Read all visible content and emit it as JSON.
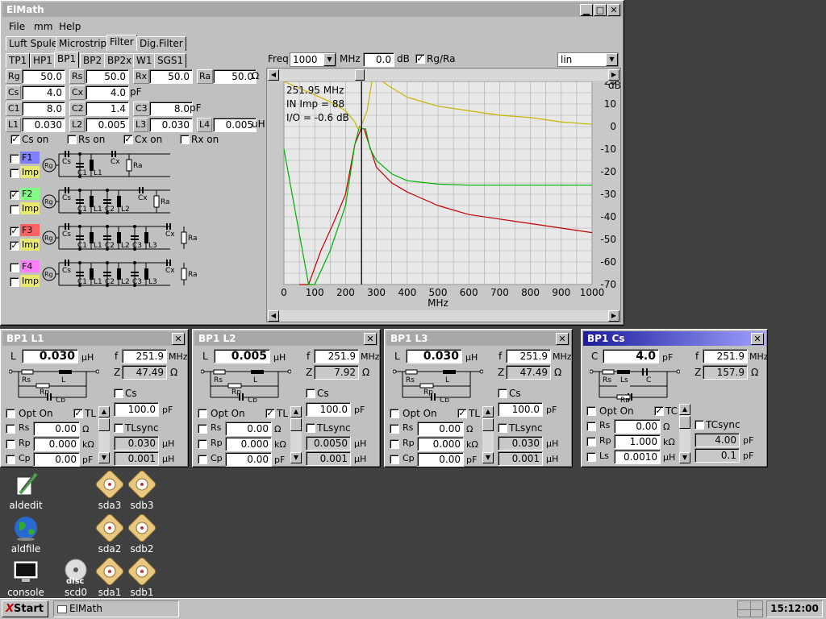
{
  "main": {
    "title": "ElMath",
    "menu": [
      "File",
      "mm",
      "Help"
    ],
    "tabs": [
      "Luft Spule",
      "Microstrip",
      "Filter",
      "Dig.Filter"
    ],
    "subtabs": [
      "TP1",
      "HP1",
      "BP1",
      "BP2",
      "BP2x",
      "W1",
      "SGS1"
    ],
    "params": [
      {
        "label": "Rg",
        "value": "50.0"
      },
      {
        "label": "Rs",
        "value": "50.0"
      },
      {
        "label": "Rx",
        "value": "50.0"
      },
      {
        "label": "Ra",
        "value": "50.0"
      },
      {
        "label": "Cs",
        "value": "4.0"
      },
      {
        "label": "Cx",
        "value": "4.0"
      },
      {
        "label": "C1",
        "value": "8.0"
      },
      {
        "label": "C2",
        "value": "1.4"
      },
      {
        "label": "C3",
        "value": "8.0"
      },
      {
        "label": "L1",
        "value": "0.030"
      },
      {
        "label": "L2",
        "value": "0.005"
      },
      {
        "label": "L3",
        "value": "0.030"
      },
      {
        "label": "L4",
        "value": "0.005"
      }
    ],
    "units": {
      "ohm": "Ω",
      "pf": "pF",
      "uh": "uH"
    },
    "checks": {
      "cs_on": "Cs on",
      "rs_on": "Rs on",
      "cx_on": "Cx on",
      "rx_on": "Rx on"
    },
    "filters": [
      {
        "name": "F1",
        "color": "#8080ff",
        "checked": false,
        "imp": false
      },
      {
        "name": "F2",
        "color": "#80ff80",
        "checked": true,
        "imp": false
      },
      {
        "name": "F3",
        "color": "#ff6060",
        "checked": true,
        "imp": true
      },
      {
        "name": "F4",
        "color": "#ff80ff",
        "checked": false,
        "imp": false
      }
    ],
    "imp_label": "Imp",
    "freq_label": "Freq",
    "freq_value": "1000",
    "mhz_label": "MHz",
    "db_value": "0.0",
    "db_label": "dB",
    "rg_ra_label": "Rg/Ra",
    "scale_value": "lin",
    "readout": [
      "251.95 MHz",
      "IN Imp = 88",
      "I/O = -0.6 dB"
    ]
  },
  "chart_data": {
    "type": "line",
    "xlabel": "MHz",
    "ylabel": "dB",
    "xlim": [
      0,
      1000
    ],
    "ylim": [
      -70,
      20
    ],
    "xticks": [
      0,
      100,
      200,
      300,
      400,
      500,
      600,
      700,
      800,
      900,
      1000
    ],
    "yticks": [
      20,
      10,
      0,
      -10,
      -20,
      -30,
      -40,
      -50,
      -60,
      -70
    ],
    "cursor_x": 252,
    "grid": true,
    "series": [
      {
        "color": "#c00000",
        "x": [
          50,
          80,
          120,
          160,
          200,
          230,
          250,
          260,
          300,
          350,
          400,
          500,
          600,
          700,
          800,
          900,
          1000
        ],
        "y": [
          -70,
          -70,
          -55,
          -43,
          -30,
          -8,
          -1,
          -1,
          -18,
          -25,
          -29,
          -35,
          -39,
          -41,
          -43,
          -45,
          -47
        ]
      },
      {
        "color": "#00b000",
        "x": [
          0,
          80,
          100,
          150,
          200,
          230,
          245,
          255,
          265,
          280,
          300,
          350,
          400,
          500,
          600,
          700,
          800,
          1000
        ],
        "y": [
          -10,
          -70,
          -70,
          -55,
          -35,
          -8,
          0,
          -1,
          -1,
          -10,
          -15,
          -21,
          -24,
          -25.5,
          -26,
          -26,
          -26,
          -26
        ]
      },
      {
        "color": "#c8b400",
        "x": [
          0,
          50,
          100,
          150,
          200,
          230,
          240,
          250,
          270,
          290,
          300,
          310,
          320,
          340,
          400,
          500,
          600,
          700,
          800,
          900,
          1000
        ],
        "y": [
          20,
          17,
          14,
          11,
          7,
          2,
          -1,
          0,
          7,
          24,
          26,
          24,
          20,
          18,
          13,
          9,
          7,
          5,
          4,
          2,
          1
        ]
      }
    ]
  },
  "dialogs": [
    {
      "title": "BP1 L1",
      "main_label": "L",
      "main_value": "0.030",
      "main_unit": "µH",
      "f_value": "251.9",
      "z_value": "47.49",
      "check_label": "Cs",
      "check2_value": "100.0",
      "check2_unit": "pF",
      "sync_label": "TLsync",
      "sync_checked": false,
      "v1": "0.030",
      "v1u": "µH",
      "v2": "0.001",
      "v2u": "µH",
      "opt_label": "Opt On",
      "tl_label": "TL",
      "tl_checked": true,
      "rows": [
        {
          "label": "Rs",
          "value": "0.00",
          "unit": "Ω"
        },
        {
          "label": "Rp",
          "value": "0.000",
          "unit": "kΩ"
        },
        {
          "label": "Cp",
          "value": "0.00",
          "unit": "pF"
        }
      ],
      "active": false,
      "circuit": "L"
    },
    {
      "title": "BP1 L2",
      "main_label": "L",
      "main_value": "0.005",
      "main_unit": "µH",
      "f_value": "251.9",
      "z_value": "7.92",
      "check_label": "Cs",
      "check2_value": "100.0",
      "check2_unit": "pF",
      "sync_label": "TLsync",
      "sync_checked": false,
      "v1": "0.0050",
      "v1u": "µH",
      "v2": "0.001",
      "v2u": "µH",
      "opt_label": "Opt On",
      "tl_label": "TL",
      "tl_checked": true,
      "rows": [
        {
          "label": "Rs",
          "value": "0.00",
          "unit": "Ω"
        },
        {
          "label": "Rp",
          "value": "0.000",
          "unit": "kΩ"
        },
        {
          "label": "Cp",
          "value": "0.00",
          "unit": "pF"
        }
      ],
      "active": false,
      "circuit": "L"
    },
    {
      "title": "BP1 L3",
      "main_label": "L",
      "main_value": "0.030",
      "main_unit": "µH",
      "f_value": "251.9",
      "z_value": "47.49",
      "check_label": "Cs",
      "check2_value": "100.0",
      "check2_unit": "pF",
      "sync_label": "TLsync",
      "sync_checked": false,
      "v1": "0.030",
      "v1u": "µH",
      "v2": "0.001",
      "v2u": "µH",
      "opt_label": "Opt On",
      "tl_label": "TL",
      "tl_checked": true,
      "rows": [
        {
          "label": "Rs",
          "value": "0.00",
          "unit": "Ω"
        },
        {
          "label": "Rp",
          "value": "0.000",
          "unit": "kΩ"
        },
        {
          "label": "Cp",
          "value": "0.00",
          "unit": "pF"
        }
      ],
      "active": false,
      "circuit": "L"
    },
    {
      "title": "BP1 Cs",
      "main_label": "C",
      "main_value": "4.0",
      "main_unit": "pF",
      "f_value": "251.9",
      "z_value": "157.9",
      "check_label": "",
      "check2_value": "",
      "check2_unit": "",
      "sync_label": "TCsync",
      "sync_checked": false,
      "v1": "4.00",
      "v1u": "pF",
      "v2": "0.1",
      "v2u": "pF",
      "opt_label": "Opt On",
      "tl_label": "TC",
      "tl_checked": true,
      "rows": [
        {
          "label": "Rs",
          "value": "0.00",
          "unit": "Ω"
        },
        {
          "label": "Rp",
          "value": "1.000",
          "unit": "kΩ"
        },
        {
          "label": "Ls",
          "value": "0.0010",
          "unit": "µH"
        }
      ],
      "active": true,
      "circuit": "C"
    }
  ],
  "dialog_labels": {
    "f": "f",
    "z": "Z",
    "mhz": "MHz",
    "ohm": "Ω"
  },
  "desktop": [
    {
      "label": "aldedit",
      "icon": "editor-icon"
    },
    {
      "label": "aldfile",
      "icon": "globe-icon"
    },
    {
      "label": "console",
      "icon": "terminal-icon"
    },
    {
      "label": "scd0",
      "icon": "cdrom-icon"
    },
    {
      "label": "sda3",
      "icon": "harddisk-icon"
    },
    {
      "label": "sdb3",
      "icon": "harddisk-icon"
    },
    {
      "label": "sda2",
      "icon": "harddisk-icon"
    },
    {
      "label": "sdb2",
      "icon": "harddisk-icon"
    },
    {
      "label": "sda1",
      "icon": "harddisk-icon"
    },
    {
      "label": "sdb1",
      "icon": "harddisk-icon"
    }
  ],
  "taskbar": {
    "start": "Start",
    "task": "ElMath",
    "clock": "15:12:00"
  }
}
